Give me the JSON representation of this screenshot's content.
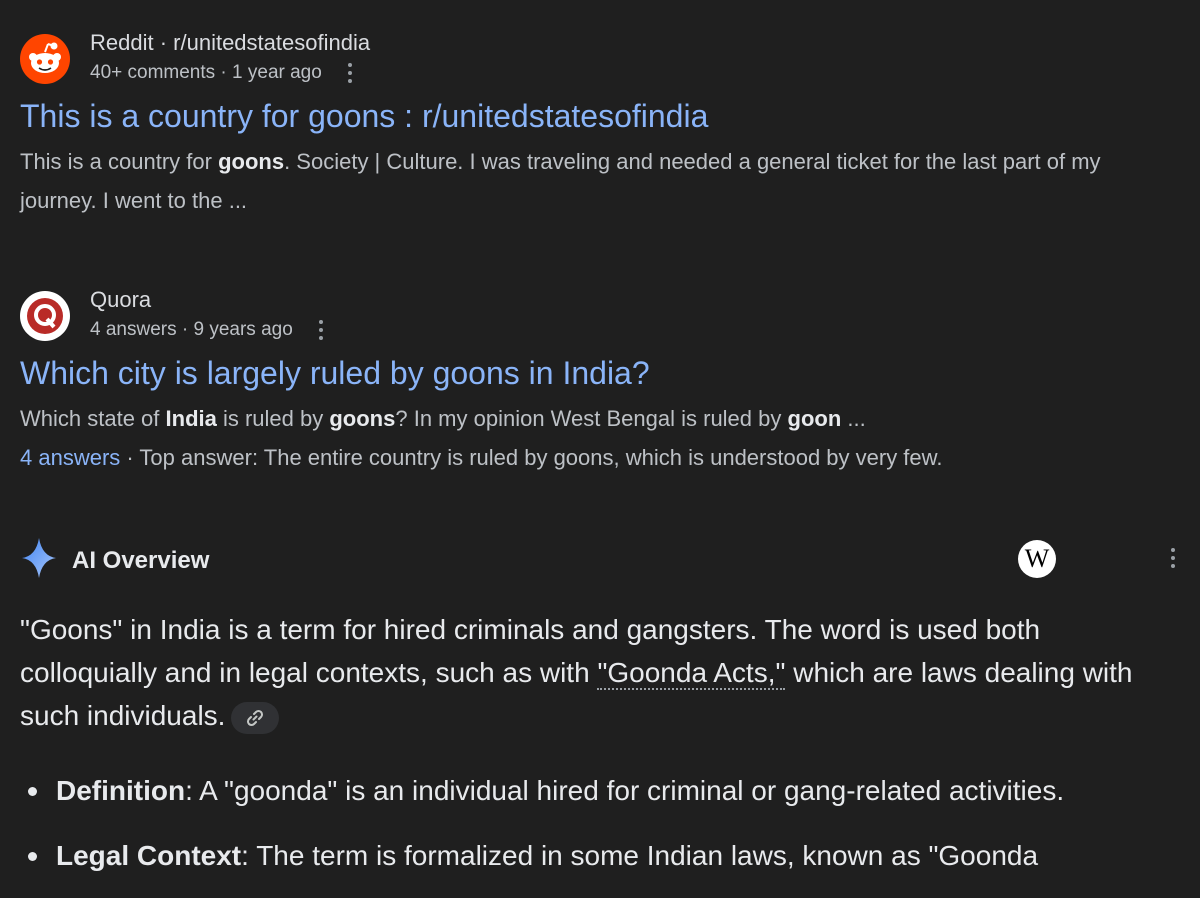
{
  "results": [
    {
      "source": "Reddit",
      "source_sub": "r/unitedstatesofindia",
      "meta": "40+ comments · 1 year ago",
      "icon": "reddit-icon",
      "title": "This is a country for goons : r/unitedstatesofindia",
      "snippet_parts": [
        "This is a country for ",
        "goons",
        ". Society | Culture. I was traveling and needed a general ticket for the last part of my journey. I went to the ..."
      ]
    },
    {
      "source": "Quora",
      "meta": "4 answers · 9 years ago",
      "icon": "quora-icon",
      "title": "Which city is largely ruled by goons in India?",
      "snippet_parts": [
        "Which state of ",
        "India",
        " is ruled by ",
        "goons",
        "? In my opinion West Bengal is ruled by ",
        "goon",
        " ..."
      ],
      "answers_link": "4 answers",
      "top_answer": " · Top answer: The entire country is ruled by goons, which is understood by very few."
    }
  ],
  "ai_overview": {
    "title": "AI Overview",
    "source_icon": "wikipedia-icon",
    "source_letter": "W",
    "body_parts": [
      "\"Goons\" in India is a term for hired criminals and gangsters. The word is used both colloquially and in legal contexts, such as with ",
      "\"Goonda Acts,\"",
      " which are laws dealing with such individuals."
    ],
    "bullets": [
      {
        "term": "Definition",
        "text": ": A \"goonda\" is an individual hired for criminal or gang-related activities."
      },
      {
        "term": "Legal Context",
        "text": ": The term is formalized in some Indian laws, known as \"Goonda"
      }
    ]
  },
  "colors": {
    "background": "#1f1f1f",
    "link": "#8ab4f8",
    "reddit": "#ff4500",
    "quora": "#b92b27",
    "sparkle": "#8ab4f8"
  }
}
